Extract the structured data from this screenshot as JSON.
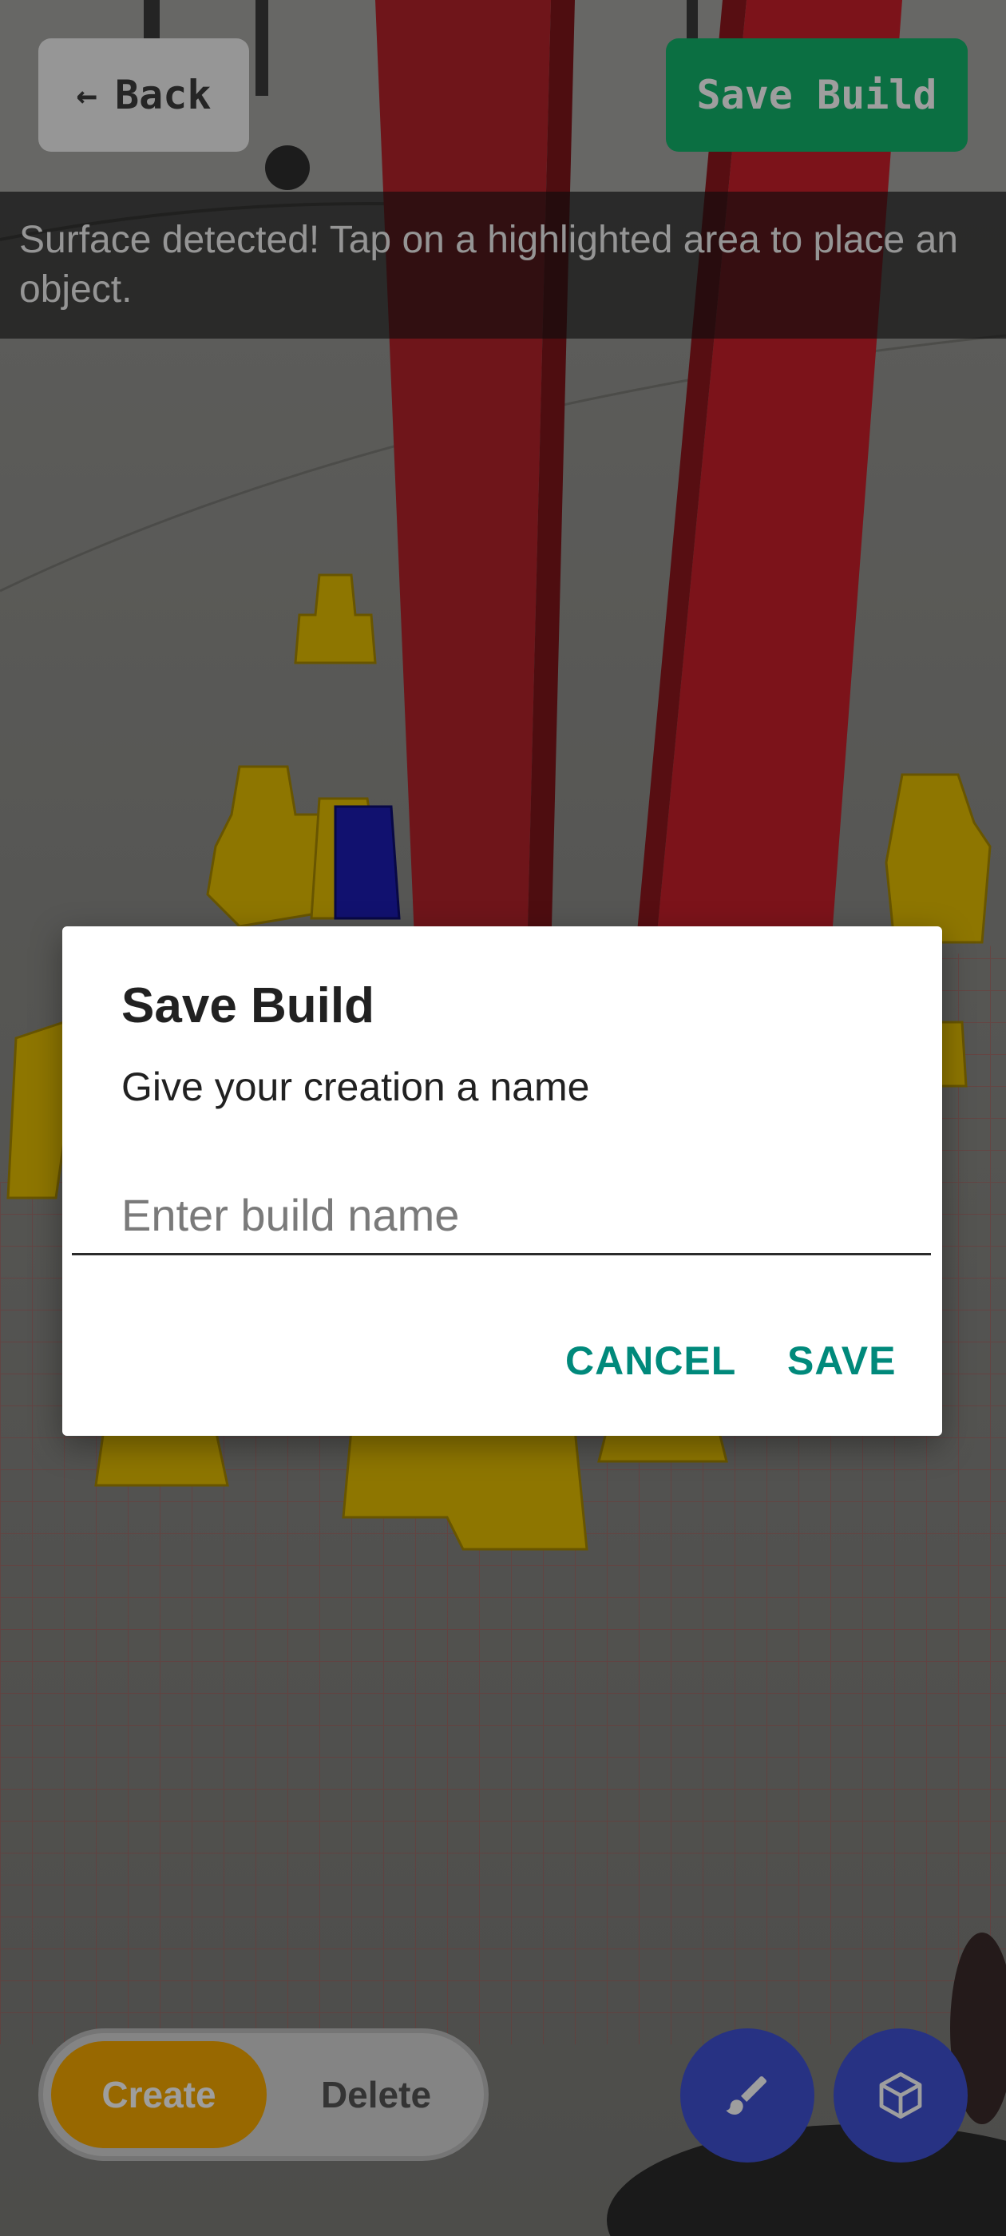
{
  "top_bar": {
    "back_label": "Back",
    "back_icon": "arrow-left-icon",
    "save_build_label": "Save Build"
  },
  "status_banner": {
    "text": "Surface detected! Tap on a highlighted area to place an object."
  },
  "mode_toggle": {
    "create_label": "Create",
    "delete_label": "Delete",
    "active": "Create"
  },
  "fabs": {
    "brush_icon": "paintbrush-icon",
    "cube_icon": "cube-icon"
  },
  "dialog": {
    "title": "Save Build",
    "message": "Give your creation a name",
    "input_value": "",
    "input_placeholder": "Enter build name",
    "cancel_label": "CANCEL",
    "save_label": "SAVE"
  },
  "colors": {
    "accent_text": "#00897b",
    "save_build_green": "#13b36b",
    "create_orange": "#f6a800",
    "fab_blue": "#3f51d4",
    "block_red": "#c8202a",
    "block_yellow": "#e8c200",
    "block_blue": "#1a1ab8"
  }
}
